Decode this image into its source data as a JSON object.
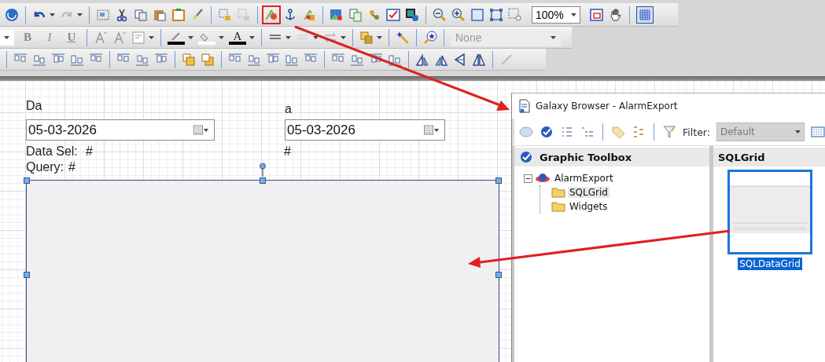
{
  "toolbar": {
    "zoom": "100%",
    "grid_toggle": {
      "selected": true
    }
  },
  "format_toolbar": {
    "styles": [
      "B",
      "I",
      "U"
    ],
    "font_color": "A",
    "effect_dropdown": "None"
  },
  "canvas": {
    "from_label": "Da",
    "from_date": "05-03-2026",
    "to_label": "a",
    "to_date": "05-03-2026",
    "data_sel_label": "Data Sel:",
    "data_sel_value": "#",
    "to_value": "#",
    "query_label": "Query:",
    "query_value": "#"
  },
  "galaxy_browser": {
    "title": "Galaxy Browser - AlarmExport",
    "filter_label": "Filter:",
    "filter_value": "Default",
    "toolbox_title": "Graphic Toolbox",
    "tree": [
      {
        "label": "AlarmExport",
        "expanded": true,
        "children": [
          {
            "label": "SQLGrid",
            "selected": true
          },
          {
            "label": "Widgets",
            "selected": false
          }
        ]
      }
    ],
    "content_title": "SQLGrid",
    "items": [
      {
        "label": "SQLDataGrid",
        "selected": true
      }
    ]
  }
}
